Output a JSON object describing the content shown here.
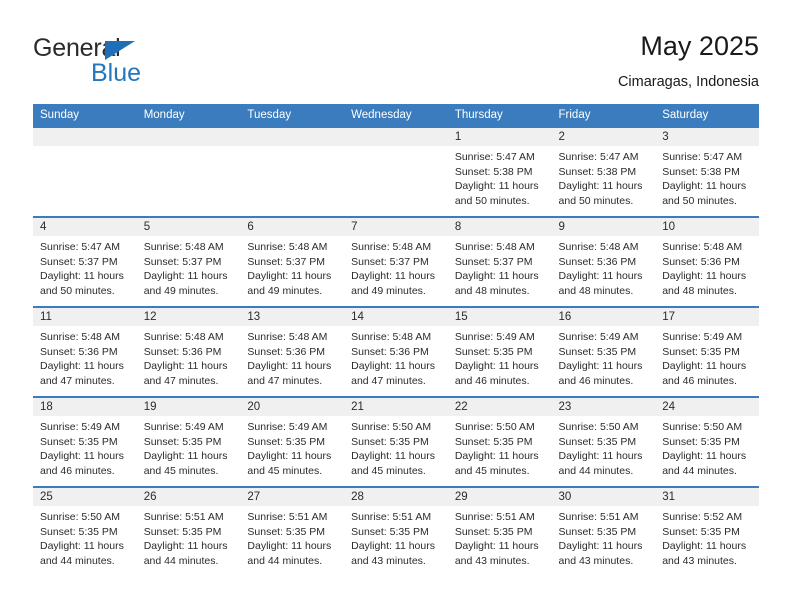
{
  "brand": {
    "name_top": "General",
    "name_bottom": "Blue",
    "accent_color": "#2277bd",
    "triangle_color": "#1f6fb8"
  },
  "header": {
    "title": "May 2025",
    "subtitle": "Cimaragas, Indonesia"
  },
  "theme": {
    "header_bg": "#3a7cbe",
    "header_text": "#ffffff",
    "daynum_bg": "#f0f0f0",
    "cell_bg": "#ffffff",
    "row_border": "#3a7cbe"
  },
  "weekdays": [
    "Sunday",
    "Monday",
    "Tuesday",
    "Wednesday",
    "Thursday",
    "Friday",
    "Saturday"
  ],
  "weeks": [
    [
      {
        "day": "",
        "sunrise": "",
        "sunset": "",
        "daylight_1": "",
        "daylight_2": ""
      },
      {
        "day": "",
        "sunrise": "",
        "sunset": "",
        "daylight_1": "",
        "daylight_2": ""
      },
      {
        "day": "",
        "sunrise": "",
        "sunset": "",
        "daylight_1": "",
        "daylight_2": ""
      },
      {
        "day": "",
        "sunrise": "",
        "sunset": "",
        "daylight_1": "",
        "daylight_2": ""
      },
      {
        "day": "1",
        "sunrise": "Sunrise: 5:47 AM",
        "sunset": "Sunset: 5:38 PM",
        "daylight_1": "Daylight: 11 hours",
        "daylight_2": "and 50 minutes."
      },
      {
        "day": "2",
        "sunrise": "Sunrise: 5:47 AM",
        "sunset": "Sunset: 5:38 PM",
        "daylight_1": "Daylight: 11 hours",
        "daylight_2": "and 50 minutes."
      },
      {
        "day": "3",
        "sunrise": "Sunrise: 5:47 AM",
        "sunset": "Sunset: 5:38 PM",
        "daylight_1": "Daylight: 11 hours",
        "daylight_2": "and 50 minutes."
      }
    ],
    [
      {
        "day": "4",
        "sunrise": "Sunrise: 5:47 AM",
        "sunset": "Sunset: 5:37 PM",
        "daylight_1": "Daylight: 11 hours",
        "daylight_2": "and 50 minutes."
      },
      {
        "day": "5",
        "sunrise": "Sunrise: 5:48 AM",
        "sunset": "Sunset: 5:37 PM",
        "daylight_1": "Daylight: 11 hours",
        "daylight_2": "and 49 minutes."
      },
      {
        "day": "6",
        "sunrise": "Sunrise: 5:48 AM",
        "sunset": "Sunset: 5:37 PM",
        "daylight_1": "Daylight: 11 hours",
        "daylight_2": "and 49 minutes."
      },
      {
        "day": "7",
        "sunrise": "Sunrise: 5:48 AM",
        "sunset": "Sunset: 5:37 PM",
        "daylight_1": "Daylight: 11 hours",
        "daylight_2": "and 49 minutes."
      },
      {
        "day": "8",
        "sunrise": "Sunrise: 5:48 AM",
        "sunset": "Sunset: 5:37 PM",
        "daylight_1": "Daylight: 11 hours",
        "daylight_2": "and 48 minutes."
      },
      {
        "day": "9",
        "sunrise": "Sunrise: 5:48 AM",
        "sunset": "Sunset: 5:36 PM",
        "daylight_1": "Daylight: 11 hours",
        "daylight_2": "and 48 minutes."
      },
      {
        "day": "10",
        "sunrise": "Sunrise: 5:48 AM",
        "sunset": "Sunset: 5:36 PM",
        "daylight_1": "Daylight: 11 hours",
        "daylight_2": "and 48 minutes."
      }
    ],
    [
      {
        "day": "11",
        "sunrise": "Sunrise: 5:48 AM",
        "sunset": "Sunset: 5:36 PM",
        "daylight_1": "Daylight: 11 hours",
        "daylight_2": "and 47 minutes."
      },
      {
        "day": "12",
        "sunrise": "Sunrise: 5:48 AM",
        "sunset": "Sunset: 5:36 PM",
        "daylight_1": "Daylight: 11 hours",
        "daylight_2": "and 47 minutes."
      },
      {
        "day": "13",
        "sunrise": "Sunrise: 5:48 AM",
        "sunset": "Sunset: 5:36 PM",
        "daylight_1": "Daylight: 11 hours",
        "daylight_2": "and 47 minutes."
      },
      {
        "day": "14",
        "sunrise": "Sunrise: 5:48 AM",
        "sunset": "Sunset: 5:36 PM",
        "daylight_1": "Daylight: 11 hours",
        "daylight_2": "and 47 minutes."
      },
      {
        "day": "15",
        "sunrise": "Sunrise: 5:49 AM",
        "sunset": "Sunset: 5:35 PM",
        "daylight_1": "Daylight: 11 hours",
        "daylight_2": "and 46 minutes."
      },
      {
        "day": "16",
        "sunrise": "Sunrise: 5:49 AM",
        "sunset": "Sunset: 5:35 PM",
        "daylight_1": "Daylight: 11 hours",
        "daylight_2": "and 46 minutes."
      },
      {
        "day": "17",
        "sunrise": "Sunrise: 5:49 AM",
        "sunset": "Sunset: 5:35 PM",
        "daylight_1": "Daylight: 11 hours",
        "daylight_2": "and 46 minutes."
      }
    ],
    [
      {
        "day": "18",
        "sunrise": "Sunrise: 5:49 AM",
        "sunset": "Sunset: 5:35 PM",
        "daylight_1": "Daylight: 11 hours",
        "daylight_2": "and 46 minutes."
      },
      {
        "day": "19",
        "sunrise": "Sunrise: 5:49 AM",
        "sunset": "Sunset: 5:35 PM",
        "daylight_1": "Daylight: 11 hours",
        "daylight_2": "and 45 minutes."
      },
      {
        "day": "20",
        "sunrise": "Sunrise: 5:49 AM",
        "sunset": "Sunset: 5:35 PM",
        "daylight_1": "Daylight: 11 hours",
        "daylight_2": "and 45 minutes."
      },
      {
        "day": "21",
        "sunrise": "Sunrise: 5:50 AM",
        "sunset": "Sunset: 5:35 PM",
        "daylight_1": "Daylight: 11 hours",
        "daylight_2": "and 45 minutes."
      },
      {
        "day": "22",
        "sunrise": "Sunrise: 5:50 AM",
        "sunset": "Sunset: 5:35 PM",
        "daylight_1": "Daylight: 11 hours",
        "daylight_2": "and 45 minutes."
      },
      {
        "day": "23",
        "sunrise": "Sunrise: 5:50 AM",
        "sunset": "Sunset: 5:35 PM",
        "daylight_1": "Daylight: 11 hours",
        "daylight_2": "and 44 minutes."
      },
      {
        "day": "24",
        "sunrise": "Sunrise: 5:50 AM",
        "sunset": "Sunset: 5:35 PM",
        "daylight_1": "Daylight: 11 hours",
        "daylight_2": "and 44 minutes."
      }
    ],
    [
      {
        "day": "25",
        "sunrise": "Sunrise: 5:50 AM",
        "sunset": "Sunset: 5:35 PM",
        "daylight_1": "Daylight: 11 hours",
        "daylight_2": "and 44 minutes."
      },
      {
        "day": "26",
        "sunrise": "Sunrise: 5:51 AM",
        "sunset": "Sunset: 5:35 PM",
        "daylight_1": "Daylight: 11 hours",
        "daylight_2": "and 44 minutes."
      },
      {
        "day": "27",
        "sunrise": "Sunrise: 5:51 AM",
        "sunset": "Sunset: 5:35 PM",
        "daylight_1": "Daylight: 11 hours",
        "daylight_2": "and 44 minutes."
      },
      {
        "day": "28",
        "sunrise": "Sunrise: 5:51 AM",
        "sunset": "Sunset: 5:35 PM",
        "daylight_1": "Daylight: 11 hours",
        "daylight_2": "and 43 minutes."
      },
      {
        "day": "29",
        "sunrise": "Sunrise: 5:51 AM",
        "sunset": "Sunset: 5:35 PM",
        "daylight_1": "Daylight: 11 hours",
        "daylight_2": "and 43 minutes."
      },
      {
        "day": "30",
        "sunrise": "Sunrise: 5:51 AM",
        "sunset": "Sunset: 5:35 PM",
        "daylight_1": "Daylight: 11 hours",
        "daylight_2": "and 43 minutes."
      },
      {
        "day": "31",
        "sunrise": "Sunrise: 5:52 AM",
        "sunset": "Sunset: 5:35 PM",
        "daylight_1": "Daylight: 11 hours",
        "daylight_2": "and 43 minutes."
      }
    ]
  ]
}
